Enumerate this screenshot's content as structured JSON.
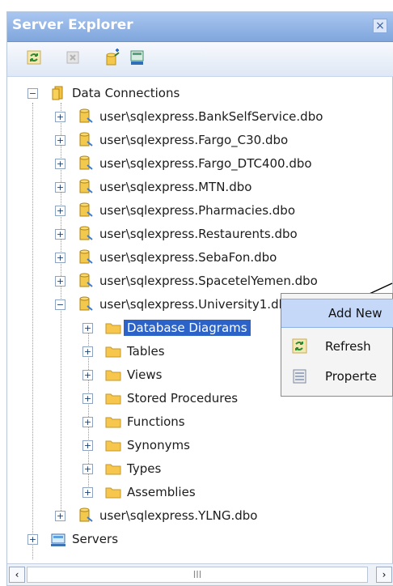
{
  "window": {
    "title": "Server Explorer"
  },
  "toolbar": {
    "buttons": [
      "refresh-icon",
      "stop-icon",
      "connect-database-icon",
      "connect-server-icon"
    ]
  },
  "tree": {
    "data_connections": "Data Connections",
    "connections": [
      "user\\sqlexpress.BankSelfService.dbo",
      "user\\sqlexpress.Fargo_C30.dbo",
      "user\\sqlexpress.Fargo_DTC400.dbo",
      "user\\sqlexpress.MTN.dbo",
      "user\\sqlexpress.Pharmacies.dbo",
      "user\\sqlexpress.Restaurents.dbo",
      "user\\sqlexpress.SebaFon.dbo",
      "user\\sqlexpress.SpacetelYemen.dbo",
      "user\\sqlexpress.University1.dbo"
    ],
    "university_children": [
      "Database Diagrams",
      "Tables",
      "Views",
      "Stored Procedures",
      "Functions",
      "Synonyms",
      "Types",
      "Assemblies"
    ],
    "last_connection": "user\\sqlexpress.YLNG.dbo",
    "servers": "Servers"
  },
  "context_menu": {
    "items": [
      "Add New",
      "Refresh",
      "Properte"
    ]
  },
  "scrollbar": {
    "thumb_glyph": "III"
  },
  "colors": {
    "title_bar": "#8fb2e4",
    "selection": "#2c63c9",
    "menu_highlight": "#c6d8f7"
  }
}
